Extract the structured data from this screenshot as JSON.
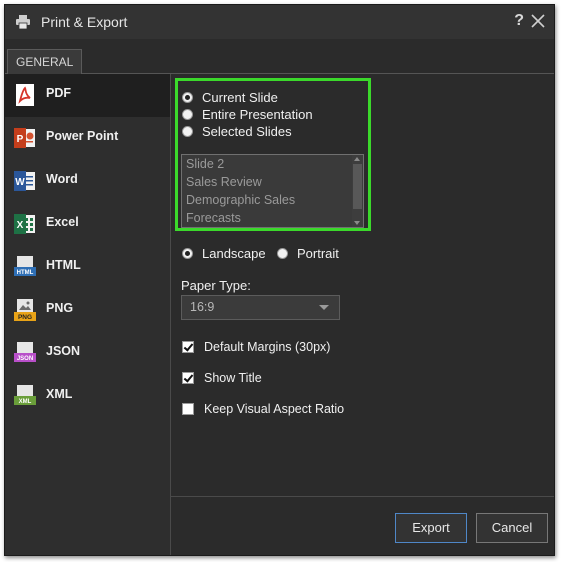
{
  "window": {
    "title": "Print & Export",
    "help_label": "?"
  },
  "tabs": [
    {
      "label": "GENERAL"
    }
  ],
  "sidebar": {
    "items": [
      {
        "label": "PDF",
        "icon": "pdf-icon"
      },
      {
        "label": "Power Point",
        "icon": "powerpoint-icon"
      },
      {
        "label": "Word",
        "icon": "word-icon"
      },
      {
        "label": "Excel",
        "icon": "excel-icon"
      },
      {
        "label": "HTML",
        "icon": "html-icon"
      },
      {
        "label": "PNG",
        "icon": "png-icon"
      },
      {
        "label": "JSON",
        "icon": "json-icon"
      },
      {
        "label": "XML",
        "icon": "xml-icon"
      }
    ],
    "icon_texts": {
      "html": "HTML",
      "png": "PNG",
      "json": "JSON",
      "xml": "XML"
    }
  },
  "scope": {
    "options": [
      "Current Slide",
      "Entire Presentation",
      "Selected Slides"
    ],
    "selected": "Current Slide"
  },
  "slides_list": [
    "Slide 2",
    "Sales Review",
    "Demographic Sales",
    "Forecasts"
  ],
  "orientation": {
    "options": [
      "Landscape",
      "Portrait"
    ],
    "selected": "Landscape"
  },
  "paper_type": {
    "label": "Paper Type:",
    "value": "16:9"
  },
  "checkboxes": [
    {
      "label": "Default Margins (30px)",
      "checked": true
    },
    {
      "label": "Show Title",
      "checked": true
    },
    {
      "label": "Keep Visual Aspect Ratio",
      "checked": false
    }
  ],
  "footer": {
    "export_label": "Export",
    "cancel_label": "Cancel"
  },
  "colors": {
    "background": "#2b2b2b",
    "highlight": "#3bd92b",
    "primary_border": "#4f87c7"
  }
}
